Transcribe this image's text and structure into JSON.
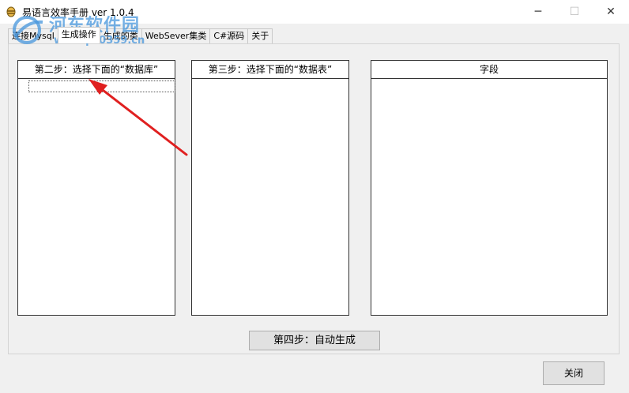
{
  "window": {
    "title": "易语言效率手册 ver 1.0.4",
    "minimize_glyph": "─",
    "maximize_glyph": "☐",
    "close_glyph": "✕"
  },
  "watermark": {
    "name": "河东软件园",
    "url": "www.pc0359.cn"
  },
  "tabs": [
    {
      "label": "连接Mysql",
      "active": false
    },
    {
      "label": "生成操作",
      "active": true
    },
    {
      "label": "生成的类",
      "active": false
    },
    {
      "label": "WebSever集类",
      "active": false
    },
    {
      "label": "C#源码",
      "active": false
    },
    {
      "label": "关于",
      "active": false
    }
  ],
  "step2": {
    "header": "第二步：选择下面的“数据库”"
  },
  "step3": {
    "header": "第三步：选择下面的“数据表”"
  },
  "fields": {
    "header": "字段"
  },
  "buttons": {
    "generate": "第四步：自动生成",
    "close": "关闭"
  },
  "colors": {
    "arrow": "#e02020",
    "watermark": "#4696dc"
  }
}
